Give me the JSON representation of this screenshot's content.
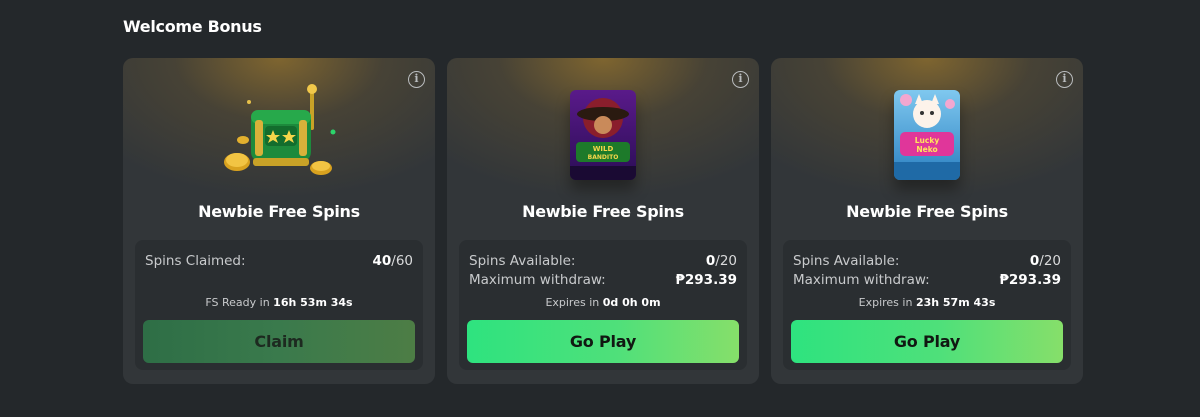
{
  "section": {
    "title": "Welcome Bonus"
  },
  "cards": [
    {
      "title": "Newbie Free Spins",
      "art": "slot-machine-icon",
      "rows": [
        {
          "label": "Spins Claimed:",
          "value_main": "40",
          "value_rest": "/60"
        }
      ],
      "timer_label": "FS Ready in ",
      "timer_value": "16h 53m 34s",
      "button_label": "Claim",
      "button_state": "disabled"
    },
    {
      "title": "Newbie Free Spins",
      "art": "wild-bandito-game-thumbnail",
      "thumb_text": "WILD BANDITO",
      "rows": [
        {
          "label": "Spins Available:",
          "value_main": "0",
          "value_rest": "/20"
        },
        {
          "label": "Maximum withdraw:",
          "value_main": "₱293.39",
          "value_rest": ""
        }
      ],
      "timer_label": "Expires in ",
      "timer_value": "0d 0h 0m",
      "button_label": "Go Play",
      "button_state": "active"
    },
    {
      "title": "Newbie Free Spins",
      "art": "lucky-neko-game-thumbnail",
      "thumb_text": "Lucky Neko",
      "rows": [
        {
          "label": "Spins Available:",
          "value_main": "0",
          "value_rest": "/20"
        },
        {
          "label": "Maximum withdraw:",
          "value_main": "₱293.39",
          "value_rest": ""
        }
      ],
      "timer_label": "Expires in ",
      "timer_value": "23h 57m 43s",
      "button_label": "Go Play",
      "button_state": "active"
    }
  ],
  "colors": {
    "background": "#24282b",
    "card": "#323639",
    "panel": "#2a2e31",
    "play_button": "#2ee37f",
    "claim_button": "#2e6e46"
  }
}
